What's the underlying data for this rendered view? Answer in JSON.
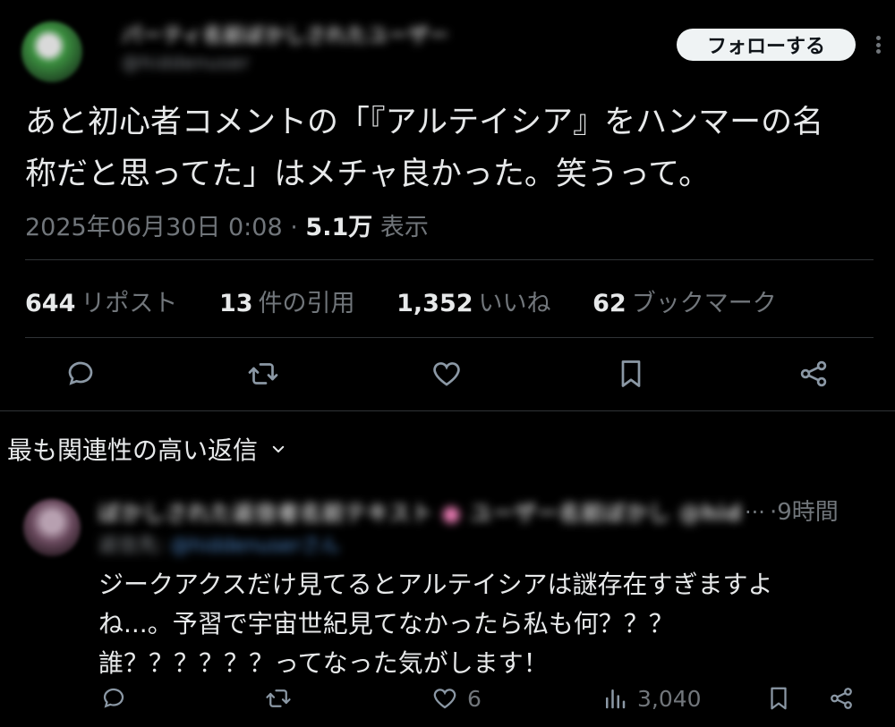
{
  "post": {
    "author_name": "パーティ名前ぼかしされたユーザー",
    "author_handle": "@hiddenuser",
    "follow_label": "フォローする",
    "text_line1": "あと初心者コメントの「『アルテイシア』をハンマーの名",
    "text_line2": "称だと思ってた」はメチャ良かった。笑うって。",
    "timestamp": "2025年06月30日 0:08",
    "separator": "·",
    "views_count": "5.1万",
    "views_label": "表示",
    "stats": {
      "reposts_count": "644",
      "reposts_label": "リポスト",
      "quotes_count": "13",
      "quotes_label": "件の引用",
      "likes_count": "1,352",
      "likes_label": "いいね",
      "bookmarks_count": "62",
      "bookmarks_label": "ブックマーク"
    },
    "actions": [
      "reply-icon",
      "repost-icon",
      "like-icon",
      "bookmark-icon",
      "share-icon"
    ]
  },
  "sort": {
    "label": "最も関連性の高い返信"
  },
  "reply": {
    "author_name": "ぼかしされた返信者名前テキスト",
    "author_badge": "●",
    "author_name_tail": "ユーザー名前ぼかし @hidden",
    "ellipsis": "...",
    "time": "·9時間",
    "handle_prefix": "返信先:",
    "handle_link": "@hiddenuserさん",
    "text_line1": "ジークアクスだけ見てるとアルテイシアは謎存在すぎますよ",
    "text_line2": "ね...。予習で宇宙世紀見てなかったら私も何？？？",
    "text_line3": "誰？？？？？？ってなった気がします！",
    "likes_count": "6",
    "views_count": "3,040"
  },
  "colors": {
    "background": "#000000",
    "text": "#e7e9ea",
    "muted": "#71767b",
    "divider": "#2f3336",
    "follow_bg": "#eff3f4",
    "link": "#4f88c9"
  }
}
